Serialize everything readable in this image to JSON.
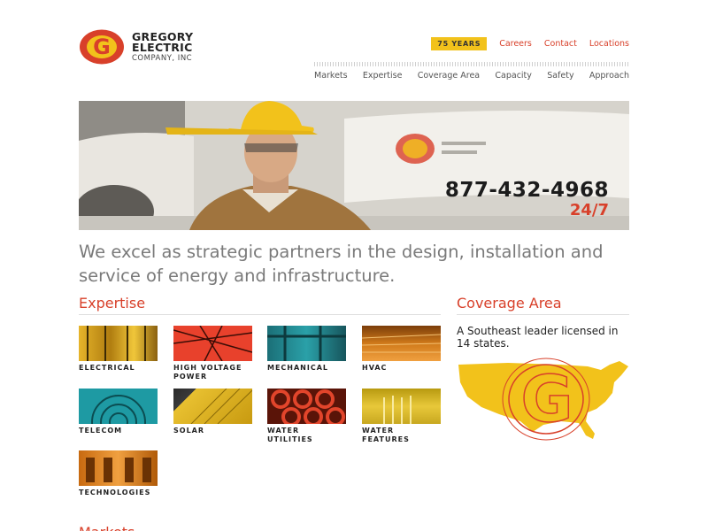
{
  "logo": {
    "line1": "GREGORY",
    "line2": "ELECTRIC",
    "line3": "COMPANY, INC"
  },
  "util_nav": {
    "badge": "75 YEARS",
    "links": [
      "Careers",
      "Contact",
      "Locations"
    ]
  },
  "main_nav": [
    "Markets",
    "Expertise",
    "Coverage Area",
    "Capacity",
    "Safety",
    "Approach"
  ],
  "hero": {
    "phone": "877-432-4968",
    "hours": "24/7"
  },
  "tagline": "We excel as strategic partners in the design, installation and service of energy and infrastructure.",
  "expertise": {
    "title": "Expertise",
    "tiles": [
      "ELECTRICAL",
      "HIGH VOLTAGE\nPOWER",
      "MECHANICAL",
      "HVAC",
      "TELECOM",
      "SOLAR",
      "WATER\nUTILITIES",
      "WATER\nFEATURES",
      "TECHNOLOGIES"
    ]
  },
  "coverage": {
    "title": "Coverage Area",
    "text": "A Southeast leader licensed in 14 states."
  },
  "markets": {
    "title": "Markets"
  },
  "colors": {
    "brand_red": "#d8402a",
    "brand_yellow": "#f2c21b",
    "text_gray": "#7a7a7a"
  }
}
